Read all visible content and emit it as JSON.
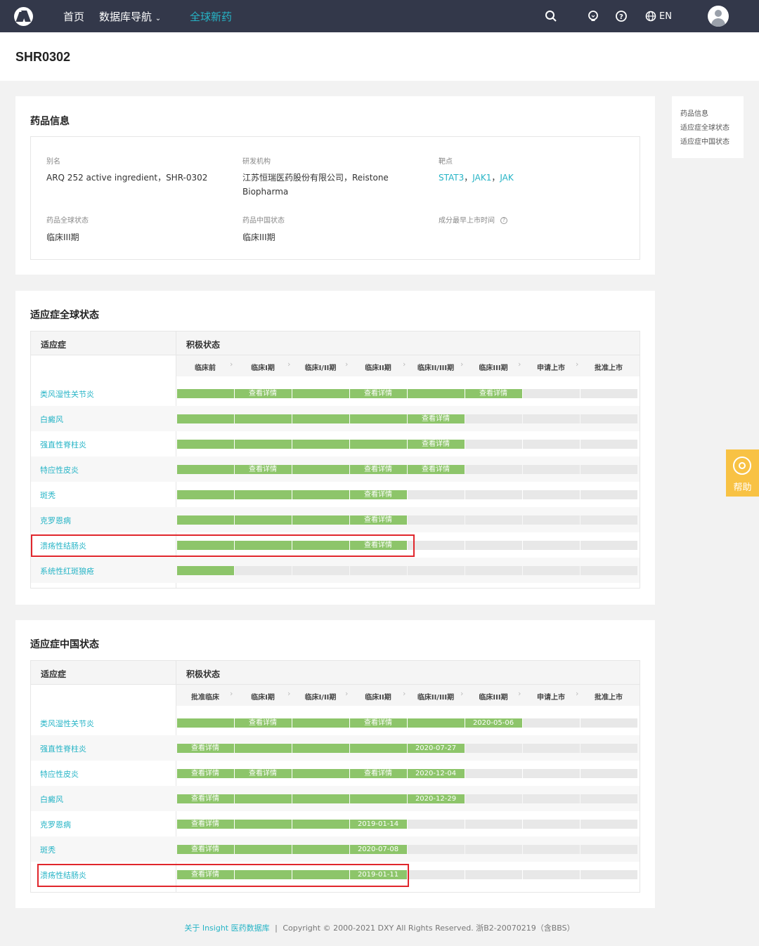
{
  "nav": {
    "home": "首页",
    "db_nav": "数据库导航",
    "global_drugs": "全球新药",
    "lang": "EN"
  },
  "page": {
    "title": "SHR0302"
  },
  "drug_info": {
    "section_title": "药品信息",
    "alias_label": "别名",
    "alias_value": "ARQ 252 active ingredient，SHR-0302",
    "org_label": "研发机构",
    "org_value_1": "江苏恒瑞医药股份有限公司，Reistone",
    "org_value_2": "Biopharma",
    "target_label": "靶点",
    "targets": [
      "STAT3",
      "JAK1",
      "JAK"
    ],
    "global_status_label": "药品全球状态",
    "global_status_value": "临床III期",
    "china_status_label": "药品中国状态",
    "china_status_value": "临床III期",
    "first_launch_label": "成分最早上市时间",
    "help_mark": "?"
  },
  "global_status": {
    "section_title": "适应症全球状态",
    "col_indication": "适应症",
    "col_status": "积极状态",
    "stages": [
      "临床前",
      "临床I期",
      "临床I/II期",
      "临床II期",
      "临床II/III期",
      "临床III期",
      "申请上市",
      "批准上市"
    ],
    "rows": [
      {
        "name": "类风湿性关节炎",
        "cells": [
          "on",
          "查看详情",
          "on",
          "查看详情",
          "on",
          "查看详情",
          "off",
          "off"
        ]
      },
      {
        "name": "白癜风",
        "cells": [
          "on",
          "on",
          "on",
          "on",
          "查看详情",
          "off",
          "off",
          "off"
        ]
      },
      {
        "name": "强直性脊柱炎",
        "cells": [
          "on",
          "on",
          "on",
          "on",
          "查看详情",
          "off",
          "off",
          "off"
        ]
      },
      {
        "name": "特应性皮炎",
        "cells": [
          "on",
          "查看详情",
          "on",
          "查看详情",
          "查看详情",
          "off",
          "off",
          "off"
        ]
      },
      {
        "name": "斑秃",
        "cells": [
          "on",
          "on",
          "on",
          "查看详情",
          "off",
          "off",
          "off",
          "off"
        ]
      },
      {
        "name": "克罗恩病",
        "cells": [
          "on",
          "on",
          "on",
          "查看详情",
          "off",
          "off",
          "off",
          "off"
        ]
      },
      {
        "name": "溃疡性结肠炎",
        "cells": [
          "on",
          "on",
          "on",
          "查看详情",
          "off",
          "off",
          "off",
          "off"
        ]
      },
      {
        "name": "系统性红斑狼疮",
        "cells": [
          "on",
          "off",
          "off",
          "off",
          "off",
          "off",
          "off",
          "off"
        ]
      }
    ]
  },
  "china_status": {
    "section_title": "适应症中国状态",
    "col_indication": "适应症",
    "col_status": "积极状态",
    "stages": [
      "批准临床",
      "临床I期",
      "临床I/II期",
      "临床II期",
      "临床II/III期",
      "临床III期",
      "申请上市",
      "批准上市"
    ],
    "rows": [
      {
        "name": "类风湿性关节炎",
        "cells": [
          "on",
          "查看详情",
          "on",
          "查看详情",
          "on",
          "2020-05-06",
          "off",
          "off"
        ]
      },
      {
        "name": "强直性脊柱炎",
        "cells": [
          "查看详情",
          "on",
          "on",
          "on",
          "2020-07-27",
          "off",
          "off",
          "off"
        ]
      },
      {
        "name": "特应性皮炎",
        "cells": [
          "查看详情",
          "查看详情",
          "on",
          "查看详情",
          "2020-12-04",
          "off",
          "off",
          "off"
        ]
      },
      {
        "name": "白癜风",
        "cells": [
          "查看详情",
          "on",
          "on",
          "on",
          "2020-12-29",
          "off",
          "off",
          "off"
        ]
      },
      {
        "name": "克罗恩病",
        "cells": [
          "查看详情",
          "on",
          "on",
          "2019-01-14",
          "off",
          "off",
          "off",
          "off"
        ]
      },
      {
        "name": "斑秃",
        "cells": [
          "查看详情",
          "on",
          "on",
          "2020-07-08",
          "off",
          "off",
          "off",
          "off"
        ]
      },
      {
        "name": "溃疡性结肠炎",
        "cells": [
          "查看详情",
          "on",
          "on",
          "2019-01-11",
          "off",
          "off",
          "off",
          "off"
        ]
      }
    ]
  },
  "side_nav": {
    "items": [
      "药品信息",
      "适应症全球状态",
      "适应症中国状态"
    ]
  },
  "help": {
    "label": "帮助"
  },
  "footer": {
    "link": "关于 Insight 医药数据库",
    "sep": "|",
    "copyright": "Copyright © 2000-2021 DXY All Rights Reserved. 浙B2-20070219（含BBS）"
  },
  "colors": {
    "accent": "#26b4c6",
    "bar_on": "#8dc56a",
    "bar_off": "#e8e8e8",
    "highlight": "#e0262c",
    "nav_bg": "#33384a"
  },
  "icons": [
    "logo-icon",
    "search-icon",
    "lightbulb-icon",
    "question-icon",
    "globe-icon",
    "avatar-icon",
    "help-icon"
  ]
}
